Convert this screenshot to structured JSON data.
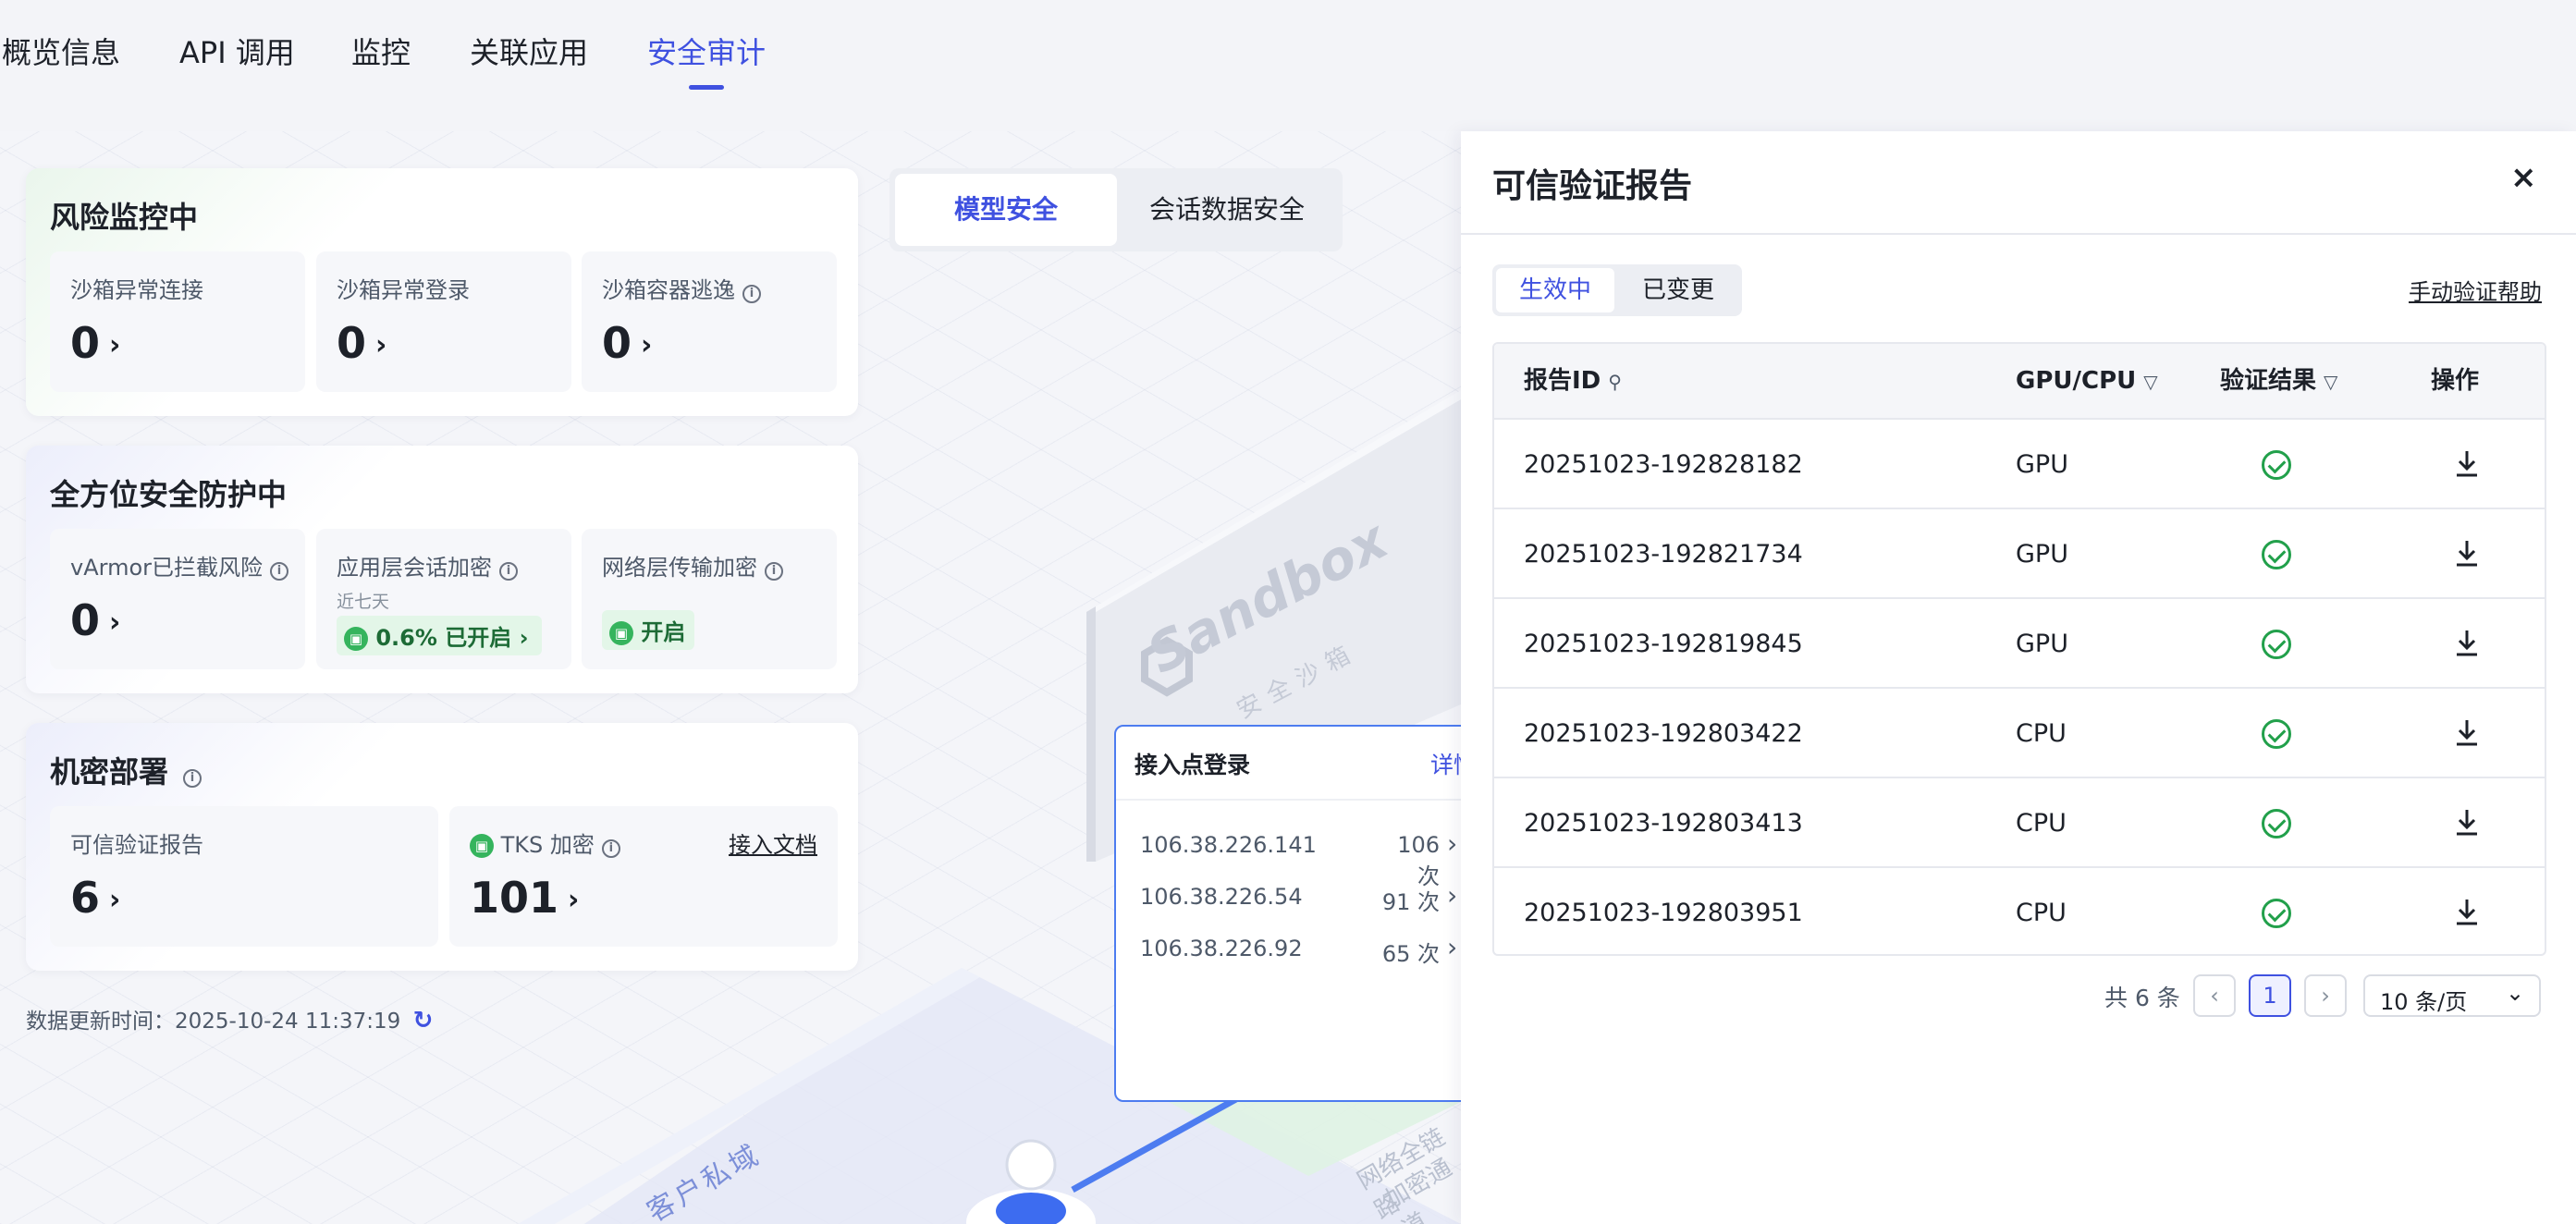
{
  "top_tabs": [
    {
      "label": "概览信息"
    },
    {
      "label": "API 调用"
    },
    {
      "label": "监控"
    },
    {
      "label": "关联应用"
    },
    {
      "label": "安全审计"
    }
  ],
  "active_tab": "安全审计",
  "risk_card": {
    "title": "风险监控中",
    "stats": [
      {
        "label": "沙箱异常连接",
        "value": "0"
      },
      {
        "label": "沙箱异常登录",
        "value": "0"
      },
      {
        "label": "沙箱容器逃逸",
        "value": "0"
      }
    ]
  },
  "protect_card": {
    "title": "全方位安全防护中",
    "stats": [
      {
        "label": "vArmor已拦截风险",
        "value": "0"
      },
      {
        "label": "应用层会话加密",
        "sub": "近七天",
        "badge": "0.6% 已开启"
      },
      {
        "label": "网络层传输加密",
        "badge": "开启"
      }
    ]
  },
  "confidential_card": {
    "title": "机密部署",
    "report_label": "可信验证报告",
    "report_value": "6",
    "tks_label": "TKS 加密",
    "tks_value": "101",
    "doc_link": "接入文档"
  },
  "update_time": "数据更新时间：2025-10-24 11:37:19",
  "segment": {
    "options": [
      "模型安全",
      "会话数据安全"
    ],
    "active": "模型安全"
  },
  "scene": {
    "sandbox_text": "Sandbox",
    "sandbox_sub": "安全沙箱",
    "private_domain": "客户私域",
    "network_text_1": "网络全链路",
    "network_text_2": "加密通道"
  },
  "access_popup": {
    "title": "接入点登录",
    "link": "详情",
    "rows": [
      {
        "ip": "106.38.226.141",
        "count": "106 次"
      },
      {
        "ip": "106.38.226.54",
        "count": "91 次"
      },
      {
        "ip": "106.38.226.92",
        "count": "65 次"
      }
    ]
  },
  "drawer": {
    "title": "可信验证报告",
    "close_icon": "close-icon",
    "segment": {
      "options": [
        "生效中",
        "已变更"
      ],
      "active": "生效中"
    },
    "help_link": "手动验证帮助",
    "columns": [
      "报告ID",
      "GPU/CPU",
      "验证结果",
      "操作"
    ],
    "rows": [
      {
        "id": "20251023-192828182",
        "type": "GPU"
      },
      {
        "id": "20251023-192821734",
        "type": "GPU"
      },
      {
        "id": "20251023-192819845",
        "type": "GPU"
      },
      {
        "id": "20251023-192803422",
        "type": "CPU"
      },
      {
        "id": "20251023-192803413",
        "type": "CPU"
      },
      {
        "id": "20251023-192803951",
        "type": "CPU"
      }
    ],
    "pagination": {
      "total": "共 6 条",
      "page": "1",
      "page_size": "10 条/页"
    }
  },
  "colors": {
    "accent": "#3f51e0",
    "success": "#22a04b",
    "text": "#1d2129",
    "muted": "#4e5969"
  }
}
